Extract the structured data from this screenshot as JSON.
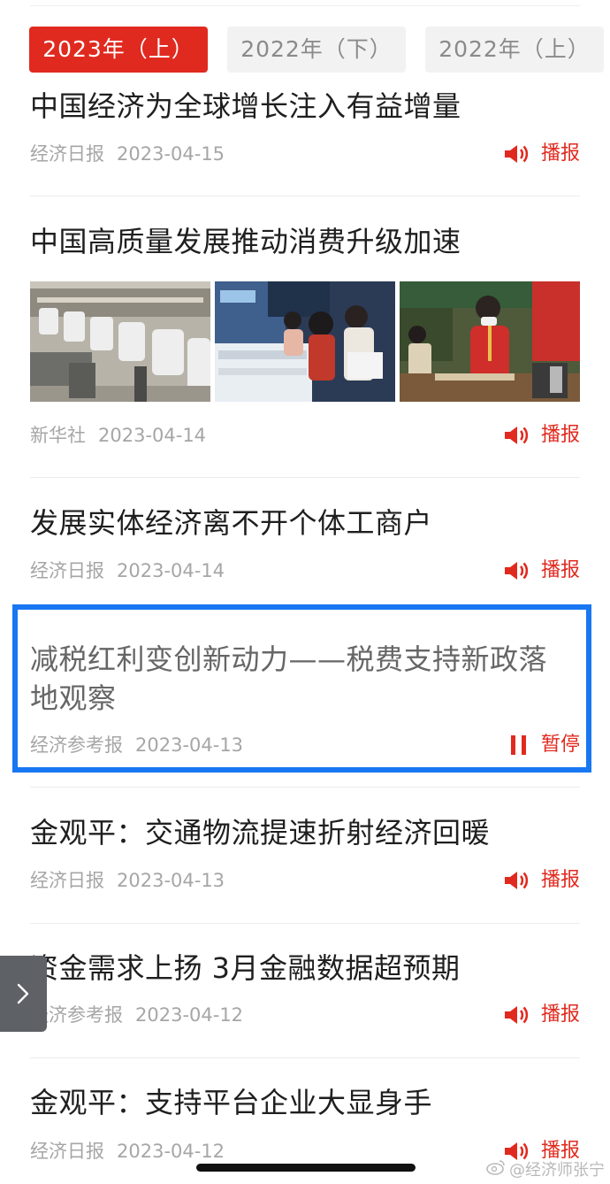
{
  "tabs": [
    {
      "label": "2023年（上）",
      "active": true
    },
    {
      "label": "2022年（下）",
      "active": false
    },
    {
      "label": "2022年（上）",
      "active": false
    }
  ],
  "news": [
    {
      "title": "中国经济为全球增长注入有益增量",
      "source": "经济日报",
      "date": "2023-04-15",
      "action": "播报",
      "state": "play"
    },
    {
      "title": "中国高质量发展推动消费升级加速",
      "source": "新华社",
      "date": "2023-04-14",
      "action": "播报",
      "state": "play",
      "images": [
        "factory-assembly-line-photo",
        "expo-visitors-photo",
        "expo-vendor-photo"
      ]
    },
    {
      "title": "发展实体经济离不开个体工商户",
      "source": "经济日报",
      "date": "2023-04-14",
      "action": "播报",
      "state": "play"
    },
    {
      "title": "减税红利变创新动力——税费支持新政落地观察",
      "source": "经济参考报",
      "date": "2023-04-13",
      "action": "暂停",
      "state": "pause"
    },
    {
      "title": "金观平：交通物流提速折射经济回暖",
      "source": "经济日报",
      "date": "2023-04-13",
      "action": "播报",
      "state": "play"
    },
    {
      "title": "资金需求上扬 3月金融数据超预期",
      "source": "经济参考报",
      "date": "2023-04-12",
      "action": "播报",
      "state": "play"
    },
    {
      "title": "金观平：支持平台企业大显身手",
      "source": "经济日报",
      "date": "2023-04-12",
      "action": "播报",
      "state": "play"
    }
  ],
  "watermark": "@经济师张宁",
  "colors": {
    "accent": "#e12a1f",
    "highlight": "#1877f2",
    "meta_text": "#a6a6a6"
  },
  "icons": {
    "play": "speaker-icon",
    "pause": "pause-icon",
    "side_handle": "chevron-right-icon",
    "watermark": "weibo-icon"
  }
}
